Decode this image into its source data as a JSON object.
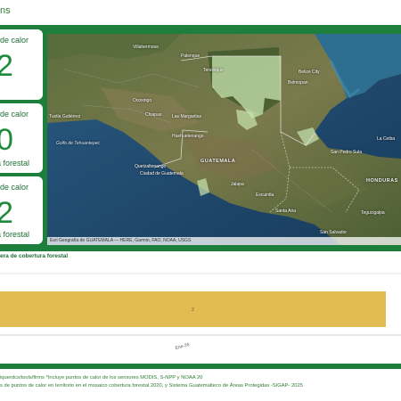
{
  "header": {
    "title": "ns"
  },
  "cards": [
    {
      "title": "os de calor",
      "value": "2",
      "subtitle": ""
    },
    {
      "title": "os de calor",
      "value": "0",
      "subtitle": "ura forestal"
    },
    {
      "title": "os de calor",
      "value": "2",
      "subtitle": "ura forestal"
    }
  ],
  "map": {
    "attribution": "Esri Geografía de GUATEMALA — HERE, Garmin, FAO, NOAA, USGS",
    "labels": {
      "guatemala": "GUATEMALA",
      "honduras": "HONDURAS",
      "belmopan": "Belmopan",
      "belize_city": "Belize City",
      "la_ceiba": "La Ceiba",
      "san_pedro_sula": "San Pedro Sula",
      "tegucigalpa": "Tegucigalpa",
      "san_salvador": "San Salvador",
      "santa_ana": "Santa Ana",
      "quetzaltenango": "Quetzaltenango",
      "guatemala_city": "Ciudad de Guatemala",
      "escuintla": "Escuintla",
      "huehuetenango": "Huehuetenango",
      "chiapas": "Chiapas",
      "las_margaritas": "Las Margaritas",
      "tuxtla": "Tuxtla Gutiérrez",
      "villahermosa": "Villahermosa",
      "palenque": "Palenque",
      "jalapa": "Jalapa",
      "ocosingo": "Ocosingo",
      "tenosique": "Tenosique",
      "pacific": "Golfo de Tehuantepec"
    }
  },
  "chart": {
    "title": "era de cobertura forestal",
    "bar_label": "2",
    "x_tick": "Ene-26"
  },
  "chart_data": {
    "type": "bar",
    "orientation": "horizontal",
    "title": "era de cobertura forestal",
    "categories": [
      ""
    ],
    "values": [
      2
    ],
    "x_ticks": [
      "Ene-26"
    ]
  },
  "footer": {
    "line1": "iquerdcs/tools/firms *Incluye puntos de calor de los sensores MODIS, S-NPP y NOAA 20",
    "line2": "s de puntos de calor en territorio en el mosaico cobertura forestal 2020, y Sistema Guatemalteco de Áreas Protegidas -SIGAP- 2025"
  },
  "colors": {
    "brand_green": "#1e7e3c",
    "bar": "#e2bb51",
    "forest_overlay": "#c8e6b0"
  }
}
